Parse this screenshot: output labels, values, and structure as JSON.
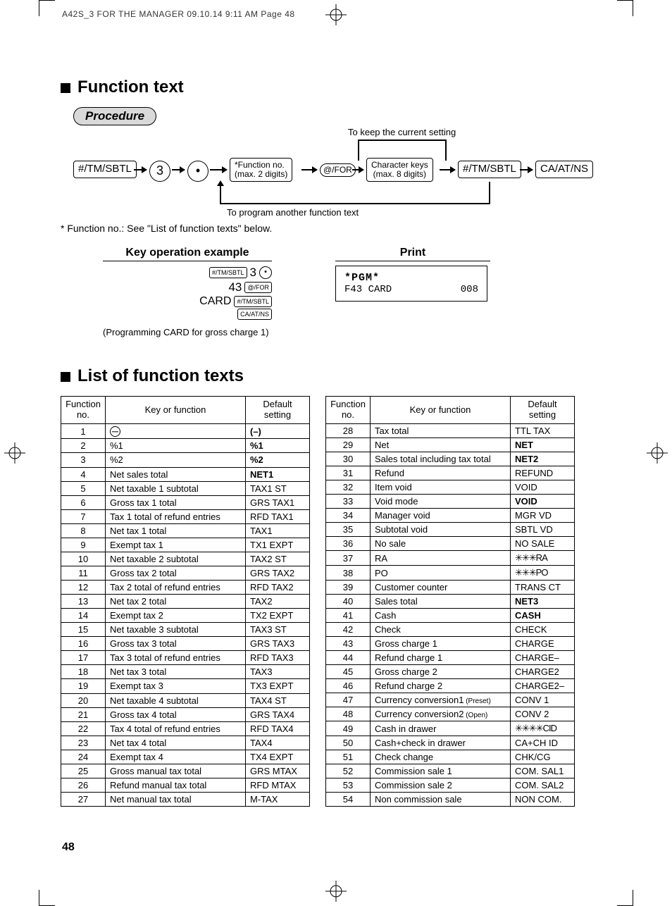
{
  "header": "A42S_3 FOR THE MANAGER  09.10.14 9:11 AM  Page 48",
  "page_number": "48",
  "section1_title": "Function text",
  "procedure_label": "Procedure",
  "flow": {
    "tmsbtl": "#/TM/SBTL",
    "three": "3",
    "dot": "•",
    "funcno": "*Function no.\n(max. 2 digits)",
    "atfor": "@/FOR",
    "charkeys": "Character keys\n(max. 8 digits)",
    "caatns": "CA/AT/NS",
    "keep": "To keep the current setting",
    "another": "To program another function text"
  },
  "footnote": "* Function no.: See \"List of function texts\" below.",
  "key_example_title": "Key operation example",
  "print_title": "Print",
  "key_example": {
    "l1_num": "3",
    "l2_num": "43",
    "l3_txt": "CARD",
    "btn_tmsbtl": "#/TM/SBTL",
    "btn_atfor": "@/FOR",
    "btn_caatns": "CA/AT/NS",
    "note": "(Programming CARD for gross charge 1)"
  },
  "print": {
    "line1": "*PGM*",
    "line2a": "F43 CARD",
    "line2b": "008"
  },
  "section2_title": "List of function texts",
  "table_headers": {
    "c1": "Function\nno.",
    "c2": "Key or function",
    "c3": "Default\nsetting"
  },
  "table_left": [
    {
      "n": "1",
      "k": "⊖",
      "d": "(–)",
      "bold": true,
      "icon": true
    },
    {
      "n": "2",
      "k": "%1",
      "d": "%1",
      "bold": true
    },
    {
      "n": "3",
      "k": "%2",
      "d": "%2",
      "bold": true
    },
    {
      "n": "4",
      "k": "Net sales total",
      "d": "NET1",
      "bold": true
    },
    {
      "n": "5",
      "k": "Net taxable 1 subtotal",
      "d": "TAX1 ST"
    },
    {
      "n": "6",
      "k": "Gross tax 1 total",
      "d": "GRS TAX1"
    },
    {
      "n": "7",
      "k": "Tax 1 total of refund entries",
      "d": "RFD TAX1"
    },
    {
      "n": "8",
      "k": "Net tax 1 total",
      "d": "TAX1"
    },
    {
      "n": "9",
      "k": "Exempt tax 1",
      "d": "TX1 EXPT"
    },
    {
      "n": "10",
      "k": "Net taxable 2 subtotal",
      "d": "TAX2 ST"
    },
    {
      "n": "11",
      "k": "Gross tax 2 total",
      "d": "GRS TAX2"
    },
    {
      "n": "12",
      "k": "Tax 2 total of refund entries",
      "d": "RFD TAX2"
    },
    {
      "n": "13",
      "k": "Net tax 2 total",
      "d": "TAX2"
    },
    {
      "n": "14",
      "k": "Exempt tax 2",
      "d": "TX2 EXPT"
    },
    {
      "n": "15",
      "k": "Net taxable 3 subtotal",
      "d": "TAX3 ST"
    },
    {
      "n": "16",
      "k": "Gross tax 3 total",
      "d": "GRS TAX3"
    },
    {
      "n": "17",
      "k": "Tax 3 total of refund entries",
      "d": "RFD TAX3"
    },
    {
      "n": "18",
      "k": "Net tax 3 total",
      "d": "TAX3"
    },
    {
      "n": "19",
      "k": "Exempt tax 3",
      "d": "TX3 EXPT"
    },
    {
      "n": "20",
      "k": "Net taxable 4 subtotal",
      "d": "TAX4 ST"
    },
    {
      "n": "21",
      "k": "Gross tax 4 total",
      "d": "GRS TAX4"
    },
    {
      "n": "22",
      "k": "Tax 4 total of refund entries",
      "d": "RFD TAX4"
    },
    {
      "n": "23",
      "k": "Net tax 4 total",
      "d": "TAX4"
    },
    {
      "n": "24",
      "k": "Exempt tax 4",
      "d": "TX4 EXPT"
    },
    {
      "n": "25",
      "k": "Gross manual tax total",
      "d": "GRS MTAX"
    },
    {
      "n": "26",
      "k": "Refund manual tax total",
      "d": "RFD MTAX"
    },
    {
      "n": "27",
      "k": "Net manual tax total",
      "d": "M-TAX"
    }
  ],
  "table_right": [
    {
      "n": "28",
      "k": "Tax total",
      "d": "TTL TAX"
    },
    {
      "n": "29",
      "k": "Net",
      "d": "NET",
      "bold": true
    },
    {
      "n": "30",
      "k": "Sales total including tax total",
      "d": "NET2",
      "bold": true
    },
    {
      "n": "31",
      "k": "Refund",
      "d": "REFUND"
    },
    {
      "n": "32",
      "k": "Item void",
      "d": "VOID"
    },
    {
      "n": "33",
      "k": "Void mode",
      "d": "VOID",
      "bold": true
    },
    {
      "n": "34",
      "k": "Manager void",
      "d": "MGR VD"
    },
    {
      "n": "35",
      "k": "Subtotal void",
      "d": "SBTL VD"
    },
    {
      "n": "36",
      "k": "No sale",
      "d": "NO SALE"
    },
    {
      "n": "37",
      "k": "RA",
      "d": "✳✳✳RA",
      "star": true
    },
    {
      "n": "38",
      "k": "PO",
      "d": "✳✳✳PO",
      "star": true
    },
    {
      "n": "39",
      "k": "Customer counter",
      "d": "TRANS CT"
    },
    {
      "n": "40",
      "k": "Sales total",
      "d": "NET3",
      "bold": true
    },
    {
      "n": "41",
      "k": "Cash",
      "d": "CASH",
      "bold": true
    },
    {
      "n": "42",
      "k": "Check",
      "d": "CHECK"
    },
    {
      "n": "43",
      "k": "Gross charge 1",
      "d": "CHARGE"
    },
    {
      "n": "44",
      "k": "Refund charge 1",
      "d": "CHARGE–"
    },
    {
      "n": "45",
      "k": "Gross charge 2",
      "d": "CHARGE2"
    },
    {
      "n": "46",
      "k": "Refund charge 2",
      "d": "CHARGE2–"
    },
    {
      "n": "47",
      "k": "Currency conversion1",
      "sub": "(Preset)",
      "d": "CONV 1"
    },
    {
      "n": "48",
      "k": "Currency conversion2",
      "sub": "(Open)",
      "d": "CONV 2"
    },
    {
      "n": "49",
      "k": "Cash in drawer",
      "d": "✳✳✳✳CID",
      "star": true
    },
    {
      "n": "50",
      "k": "Cash+check in drawer",
      "d": "CA+CH ID"
    },
    {
      "n": "51",
      "k": "Check change",
      "d": "CHK/CG"
    },
    {
      "n": "52",
      "k": "Commission sale 1",
      "d": "COM. SAL1"
    },
    {
      "n": "53",
      "k": "Commission sale 2",
      "d": "COM. SAL2"
    },
    {
      "n": "54",
      "k": "Non commission sale",
      "d": "NON COM."
    }
  ]
}
